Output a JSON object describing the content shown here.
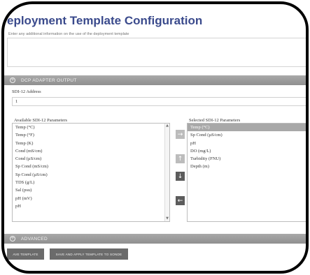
{
  "header": {
    "title": "eployment Template Configuration",
    "subtitle": "Enter any additional information on the use of the deployment template"
  },
  "notes": {
    "value": ""
  },
  "sections": {
    "dcp": {
      "label": "DCP ADAPTER OUTPUT"
    },
    "advanced": {
      "label": "ADVANCED"
    }
  },
  "sdi": {
    "address_label": "SDI-12 Address",
    "address_value": "1"
  },
  "available": {
    "label": "Available SDI-12 Parameters",
    "items": [
      "Temp (°C)",
      "Temp (°F)",
      "Temp (K)",
      "Cond (mS/cm)",
      "Cond (µS/cm)",
      "Sp Cond (mS/cm)",
      "Sp Cond (µS/cm)",
      "TDS (g/L)",
      "Sal (psu)",
      "pH (mV)",
      "pH"
    ]
  },
  "selected": {
    "label": "Selected SDI-12 Parameters",
    "items": [
      "Temp (°C)",
      "Sp Cond (µS/cm)",
      "pH",
      "DO (mg/L)",
      "Turbidity (FNU)",
      "Depth (m)"
    ]
  },
  "buttons": {
    "save": "AVE TEMPLATE",
    "save_apply": "SAVE AND APPLY TEMPLATE TO SONDE"
  },
  "icons": {
    "move_right": "→",
    "move_up": "↑",
    "move_down": "↓",
    "move_left": "←",
    "expand": "+",
    "scroll_up": "▲",
    "scroll_down": "▼"
  }
}
